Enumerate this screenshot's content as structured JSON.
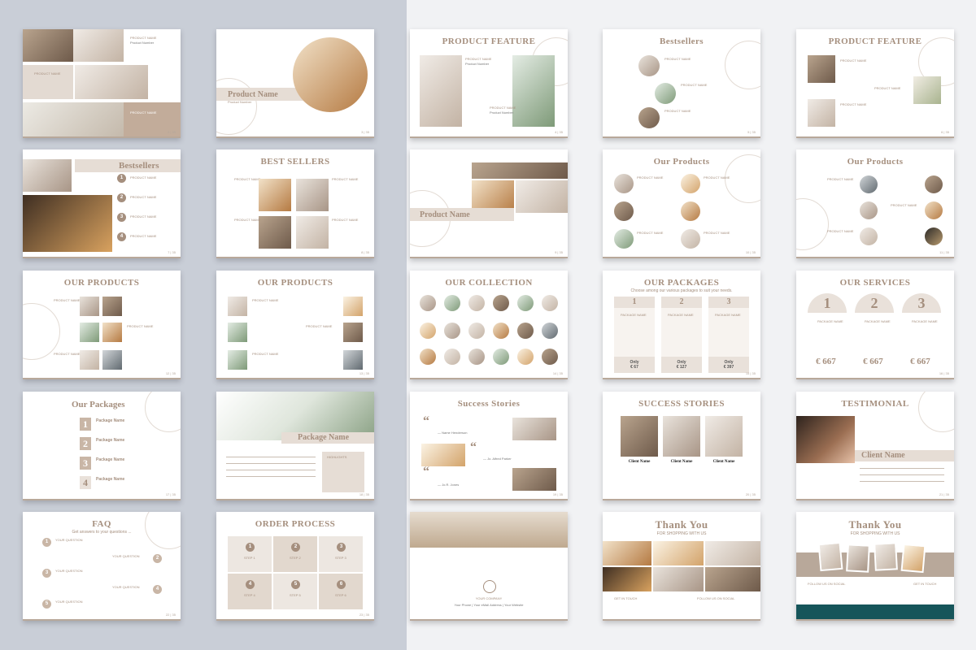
{
  "colors": {
    "accent": "#a58f7e",
    "band": "#e6ddd5",
    "left_bg": "#c9ced7",
    "right_bg": "#f1f2f4",
    "teal": "#16555a"
  },
  "slides": [
    {
      "title": "",
      "page": "2 | 35",
      "labels": [
        "PRODUCT NAME",
        "Product Number",
        "PRODUCT NAME",
        "PRODUCT NAME"
      ]
    },
    {
      "title": "Product Name",
      "page": "3 | 35",
      "labels": [
        "Product Number"
      ]
    },
    {
      "title": "PRODUCT FEATURE",
      "page": "4 | 35",
      "labels": [
        "PRODUCT NAME",
        "Product Number",
        "PRODUCT NAME",
        "Product Number"
      ]
    },
    {
      "title": "Bestsellers",
      "page": "5 | 35",
      "labels": [
        "PRODUCT NAME",
        "PRODUCT NAME",
        "PRODUCT NAME"
      ]
    },
    {
      "title": "PRODUCT FEATURE",
      "page": "6 | 35",
      "labels": [
        "PRODUCT NAME",
        "PRODUCT NAME",
        "PRODUCT NAME"
      ]
    },
    {
      "title": "Bestsellers",
      "page": "7 | 35",
      "numbers": [
        "1",
        "2",
        "3",
        "4"
      ],
      "labels": [
        "PRODUCT NAME",
        "PRODUCT NAME",
        "PRODUCT NAME",
        "PRODUCT NAME"
      ]
    },
    {
      "title": "BEST SELLERS",
      "page": "8 | 35",
      "labels": [
        "PRODUCT NAME",
        "PRODUCT NAME",
        "PRODUCT NAME",
        "PRODUCT NAME"
      ]
    },
    {
      "title": "Product Name",
      "page": "9 | 35",
      "labels": []
    },
    {
      "title": "Our Products",
      "page": "10 | 35",
      "labels": [
        "PRODUCT NAME",
        "PRODUCT NAME",
        "PRODUCT NAME",
        "PRODUCT NAME"
      ]
    },
    {
      "title": "Our Products",
      "page": "11 | 35",
      "labels": [
        "PRODUCT NAME",
        "PRODUCT NAME",
        "PRODUCT NAME"
      ]
    },
    {
      "title": "OUR PRODUCTS",
      "page": "12 | 35",
      "labels": [
        "PRODUCT NAME",
        "PRODUCT NAME",
        "PRODUCT NAME"
      ]
    },
    {
      "title": "OUR PRODUCTS",
      "page": "13 | 35",
      "labels": [
        "PRODUCT NAME",
        "PRODUCT NAME",
        "PRODUCT NAME"
      ]
    },
    {
      "title": "OUR COLLECTION",
      "page": "14 | 35",
      "labels": []
    },
    {
      "title": "OUR PACKAGES",
      "subtitle": "Choose among our various packages to suit your needs.",
      "page": "15 | 35",
      "numbers": [
        "1",
        "2",
        "3"
      ],
      "labels": [
        "PACKAGE NAME",
        "PACKAGE NAME",
        "PACKAGE NAME"
      ],
      "prices": [
        "Only\n€ 67",
        "Only\n€ 127",
        "Only\n€ 397"
      ]
    },
    {
      "title": "OUR SERVICES",
      "page": "16 | 35",
      "numbers": [
        "1",
        "2",
        "3"
      ],
      "labels": [
        "PACKAGE NAME",
        "PACKAGE NAME",
        "PACKAGE NAME"
      ],
      "prices": [
        "€ 667",
        "€ 667",
        "€ 667"
      ]
    },
    {
      "title": "Our Packages",
      "page": "17 | 35",
      "numbers": [
        "1",
        "2",
        "3",
        "4"
      ],
      "labels": [
        "Package Name",
        "Package Name",
        "Package Name",
        "Package Name"
      ]
    },
    {
      "title": "Package Name",
      "page": "18 | 35",
      "labels": [
        "HIGHLIGHTS"
      ]
    },
    {
      "title": "Success Stories",
      "page": "19 | 35",
      "labels": [
        "— Name Henderson",
        "— Jo. Alfred Parker",
        "— Jo.R. Jones"
      ]
    },
    {
      "title": "SUCCESS STORIES",
      "page": "20 | 35",
      "labels": [
        "Client Name",
        "Client Name",
        "Client Name"
      ]
    },
    {
      "title": "TESTIMONIAL",
      "page": "21 | 35",
      "labels": [
        "Client Name"
      ]
    },
    {
      "title": "FAQ",
      "subtitle": "Get answers to your questions ...",
      "page": "22 | 35",
      "numbers": [
        "1",
        "2",
        "3",
        "4",
        "5"
      ],
      "labels": [
        "YOUR QUESTION",
        "YOUR QUESTION",
        "YOUR QUESTION",
        "YOUR QUESTION",
        "YOUR QUESTION"
      ]
    },
    {
      "title": "ORDER PROCESS",
      "page": "23 | 35",
      "numbers": [
        "1",
        "2",
        "3",
        "4",
        "5",
        "6"
      ],
      "labels": [
        "STEP 1",
        "STEP 2",
        "STEP 3",
        "STEP 4",
        "STEP 5",
        "STEP 6"
      ]
    },
    {
      "title": "",
      "page": "",
      "labels": [
        "YOUR COMPANY",
        "Your Phone | Your eMail Address | Your Website"
      ]
    },
    {
      "title": "Thank You",
      "subtitle": "FOR SHOPPING WITH US",
      "page": "",
      "labels": [
        "GET IN TOUCH",
        "FOLLOW US ON SOCIAL"
      ]
    },
    {
      "title": "Thank You",
      "subtitle": "FOR SHOPPING WITH US",
      "page": "",
      "labels": [
        "FOLLOW US ON SOCIAL",
        "GET IN TOUCH"
      ]
    }
  ]
}
